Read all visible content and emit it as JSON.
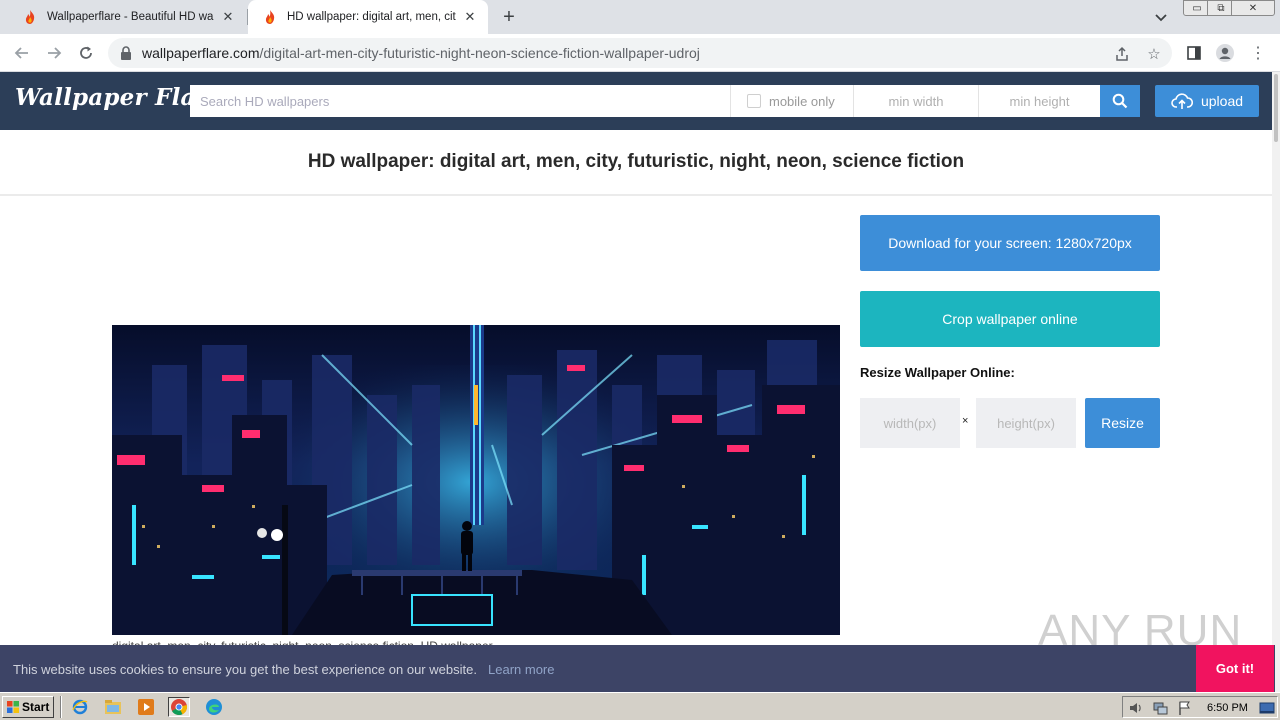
{
  "browser": {
    "tabs": [
      {
        "title": "Wallpaperflare - Beautiful HD wallpap",
        "active": false
      },
      {
        "title": "HD wallpaper: digital art, men, city, f",
        "active": true
      }
    ],
    "address": {
      "host": "wallpaperflare.com",
      "path": "/digital-art-men-city-futuristic-night-neon-science-fiction-wallpaper-udroj"
    },
    "window_controls": {
      "minimize": "▭",
      "restore": "⧉",
      "close": "✕"
    }
  },
  "site": {
    "logo": "Wallpaper Flare",
    "search": {
      "placeholder": "Search HD wallpapers",
      "mobile_only_label": "mobile only",
      "min_width_placeholder": "min width",
      "min_height_placeholder": "min height"
    },
    "upload_label": "upload"
  },
  "page": {
    "title": "HD wallpaper: digital art, men, city, futuristic, night, neon, science fiction",
    "image_caption": "digital art, men, city, futuristic, night, neon, science fiction, HD wallpaper"
  },
  "sidebar": {
    "download_label": "Download for your screen: 1280x720px",
    "crop_label": "Crop wallpaper online",
    "resize_heading": "Resize Wallpaper Online:",
    "width_placeholder": "width(px)",
    "times": "×",
    "height_placeholder": "height(px)",
    "resize_label": "Resize"
  },
  "cookie": {
    "message": "This website uses cookies to ensure you get the best experience on our website.",
    "learn_more": "Learn more",
    "got_it": "Got it!"
  },
  "watermark": {
    "text": "ANY RUN"
  },
  "taskbar": {
    "start_label": "Start",
    "clock": "6:50 PM",
    "quick_launch": [
      "ie-icon",
      "explorer-icon",
      "media-player-icon",
      "chrome-icon",
      "edge-icon"
    ]
  },
  "colors": {
    "header_bg": "#2c3e58",
    "accent_blue": "#3d8ed8",
    "crop_teal": "#1cb5bf",
    "cookie_bg": "#3d4466",
    "got_it_pink": "#f1135f"
  }
}
